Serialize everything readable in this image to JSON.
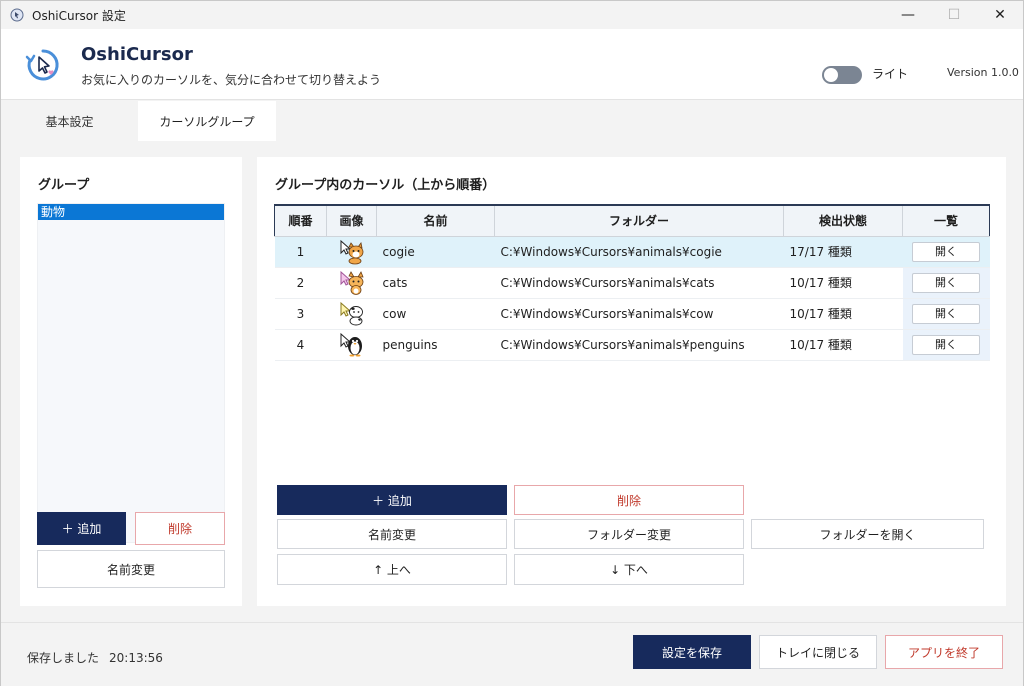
{
  "window": {
    "title": "OshiCursor 設定",
    "controls": {
      "minimize": "—",
      "maximize": "☐",
      "close": "✕"
    }
  },
  "header": {
    "app_name": "OshiCursor",
    "tagline": "お気に入りのカーソルを、気分に合わせて切り替えよう",
    "theme_label": "ライト",
    "theme_on": false,
    "version": "Version 1.0.0"
  },
  "tabs": [
    {
      "label": "基本設定",
      "active": false
    },
    {
      "label": "カーソルグループ",
      "active": true
    }
  ],
  "groups": {
    "title": "グループ",
    "items": [
      "動物"
    ],
    "selected": "動物",
    "add_label": "＋ 追加",
    "delete_label": "削除",
    "rename_label": "名前変更"
  },
  "cursors": {
    "title": "グループ内のカーソル（上から順番）",
    "columns": [
      "順番",
      "画像",
      "名前",
      "フォルダー",
      "検出状態",
      "一覧"
    ],
    "rows": [
      {
        "order": "1",
        "image": "dog-cursor-icon",
        "name": "cogie",
        "folder": "C:¥Windows¥Cursors¥animals¥cogie",
        "status": "17/17 種類",
        "open": "開く"
      },
      {
        "order": "2",
        "image": "cat-cursor-icon",
        "name": "cats",
        "folder": "C:¥Windows¥Cursors¥animals¥cats",
        "status": "10/17 種類",
        "open": "開く"
      },
      {
        "order": "3",
        "image": "cow-cursor-icon",
        "name": "cow",
        "folder": "C:¥Windows¥Cursors¥animals¥cow",
        "status": "10/17 種類",
        "open": "開く"
      },
      {
        "order": "4",
        "image": "penguin-cursor-icon",
        "name": "penguins",
        "folder": "C:¥Windows¥Cursors¥animals¥penguins",
        "status": "10/17 種類",
        "open": "開く"
      }
    ],
    "selected_row": 0,
    "add_label": "＋ 追加",
    "delete_label": "削除",
    "rename_label": "名前変更",
    "change_folder_label": "フォルダー変更",
    "open_folder_label": "フォルダーを開く",
    "up_label": "↑ 上へ",
    "down_label": "↓ 下へ"
  },
  "footer": {
    "status": "保存しました",
    "time": "20:13:56",
    "save_label": "設定を保存",
    "tray_label": "トレイに閉じる",
    "quit_label": "アプリを終了"
  },
  "colors": {
    "primary": "#172a5c",
    "selection": "#0b77d5",
    "danger": "#c0392b",
    "row_highlight": "#dff2fa"
  }
}
